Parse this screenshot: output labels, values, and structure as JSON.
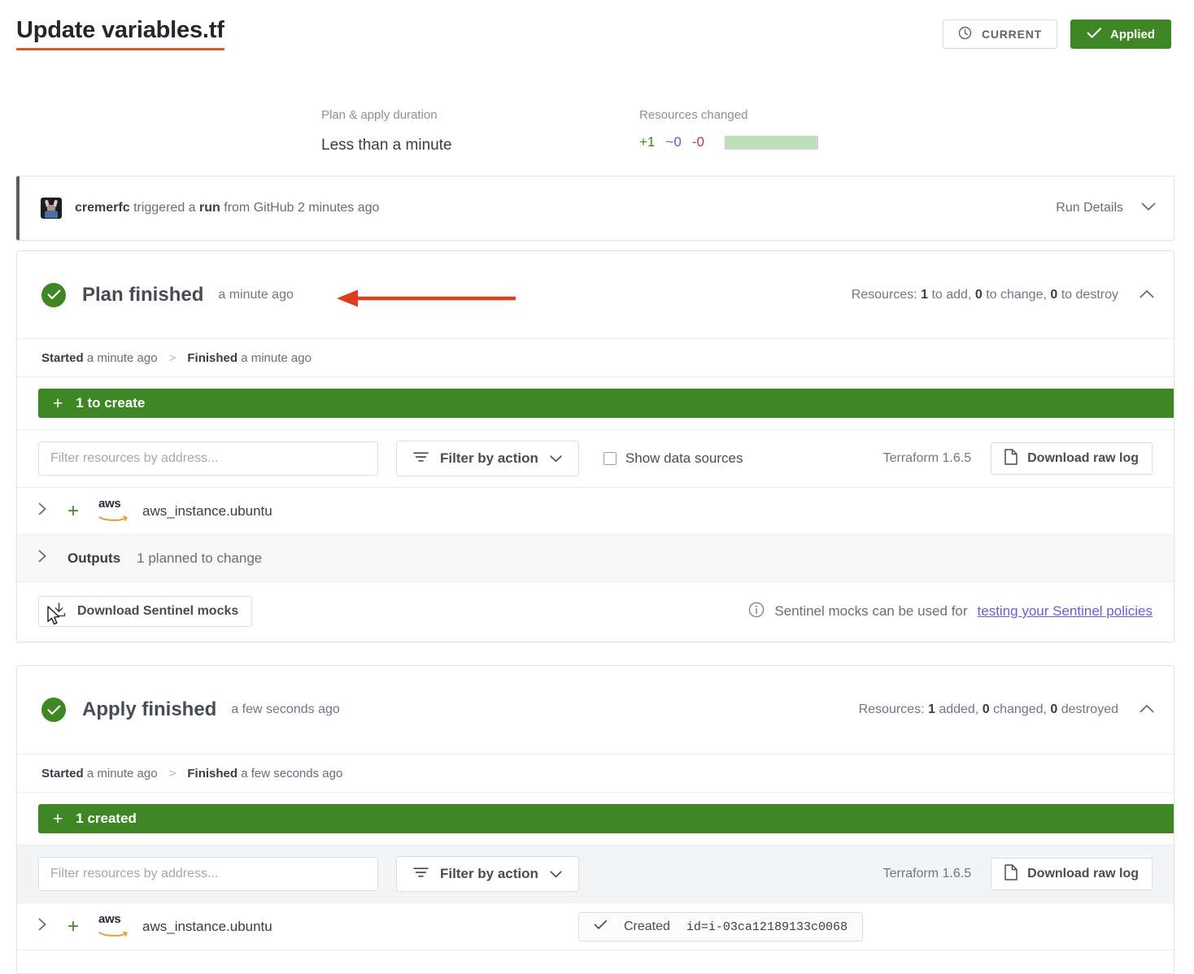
{
  "header": {
    "title": "Update variables.tf",
    "current_button": "CURRENT",
    "current_icon": "clock-icon",
    "applied_button": "Applied",
    "applied_icon": "check-icon",
    "title_underline_color": "#e8502a",
    "applied_color": "#3f8624"
  },
  "summary": {
    "duration_label": "Plan & apply duration",
    "duration_value": "Less than a minute",
    "resources_label": "Resources changed",
    "added": "+1",
    "changed": "~0",
    "destroyed": "-0",
    "added_color": "#3f8624",
    "changed_color": "#5b5bd6",
    "destroyed_color": "#c4344a",
    "bar_color": "#bfe0bd"
  },
  "trigger": {
    "avatar_name": "cremerfc-avatar",
    "user": "cremerfc",
    "text_1": "triggered a",
    "entity": "run",
    "text_2": "from GitHub 2 minutes ago",
    "run_details_label": "Run Details",
    "chevron_icon": "chevron-down-icon"
  },
  "plan": {
    "title": "Plan finished",
    "time": "a minute ago",
    "resources_prefix": "Resources:",
    "add_count": "1",
    "add_label": "to add,",
    "change_count": "0",
    "change_label": "to change,",
    "destroy_count": "0",
    "destroy_label": "to destroy",
    "collapse_icon": "chevron-up-icon",
    "started_label": "Started",
    "started_time": "a minute ago",
    "separator": ">",
    "finished_label": "Finished",
    "finished_time": "a minute ago",
    "create_bar": "1 to create",
    "filter_placeholder": "Filter resources by address...",
    "filter_action_label": "Filter by action",
    "show_data_sources_label": "Show data sources",
    "terraform_version": "Terraform 1.6.5",
    "download_log_label": "Download raw log",
    "resource_name": "aws_instance.ubuntu",
    "resource_provider": "aws",
    "outputs_label": "Outputs",
    "outputs_note": "1 planned to change",
    "sentinel_button": "Download Sentinel mocks",
    "sentinel_note": "Sentinel mocks can be used for",
    "sentinel_link": "testing your Sentinel policies",
    "annotation": "red-arrow-pointing-left"
  },
  "apply": {
    "title": "Apply finished",
    "time": "a few seconds ago",
    "resources_prefix": "Resources:",
    "added_count": "1",
    "added_label": "added,",
    "changed_count": "0",
    "changed_label": "changed,",
    "destroyed_count": "0",
    "destroyed_label": "destroyed",
    "collapse_icon": "chevron-up-icon",
    "started_label": "Started",
    "started_time": "a minute ago",
    "separator": ">",
    "finished_label": "Finished",
    "finished_time": "a few seconds ago",
    "created_bar": "1 created",
    "filter_placeholder": "Filter resources by address...",
    "filter_action_label": "Filter by action",
    "terraform_version": "Terraform 1.6.5",
    "download_log_label": "Download raw log",
    "resource_name": "aws_instance.ubuntu",
    "resource_provider": "aws",
    "created_status": "Created",
    "created_id": "id=i-03ca12189133c0068"
  }
}
